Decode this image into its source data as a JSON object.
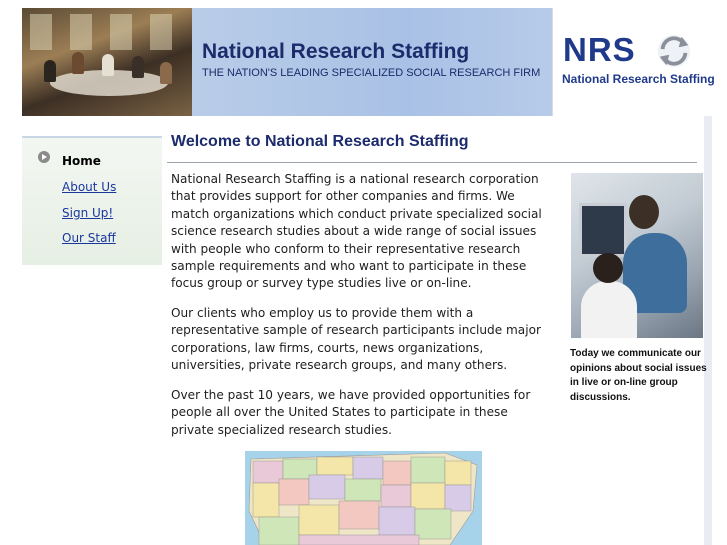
{
  "header": {
    "title": "National Research Staffing",
    "subtitle": "THE NATION'S LEADING SPECIALIZED SOCIAL RESEARCH FIRM",
    "logo_mark": "NRS",
    "logo_name": "National Research Staffing"
  },
  "sidebar": {
    "items": [
      {
        "label": "Home",
        "active": true
      },
      {
        "label": "About Us",
        "active": false
      },
      {
        "label": "Sign Up!",
        "active": false
      },
      {
        "label": "Our Staff",
        "active": false
      }
    ]
  },
  "main": {
    "title": "Welcome to National Research Staffing",
    "paragraphs": [
      "National Research Staffing is a national research corporation that provides support for other companies and firms. We match organizations which conduct private specialized social science research studies about a wide range of social issues with people who conform to their representative research sample requirements and who want to participate in these focus group or survey type studies live or on-line.",
      "Our clients who employ us to provide them with a representative sample of research participants include major corporations, law firms, courts, news organizations, universities, private research groups, and many others.",
      "Over the past 10 years, we have provided opportunities for people all over the United States to participate in these private specialized research studies."
    ]
  },
  "aside": {
    "caption": "Today we communicate our opinions about social issues in live or on-line group discussions."
  },
  "colors": {
    "title": "#1c2b6b",
    "link": "#1a37a0",
    "header_band": "#a9c1e6",
    "sidebar_bg": "#e6efe4"
  },
  "icons": {
    "nav_bullet": "play-circle-icon",
    "logo": "recycle-arrows-icon"
  }
}
